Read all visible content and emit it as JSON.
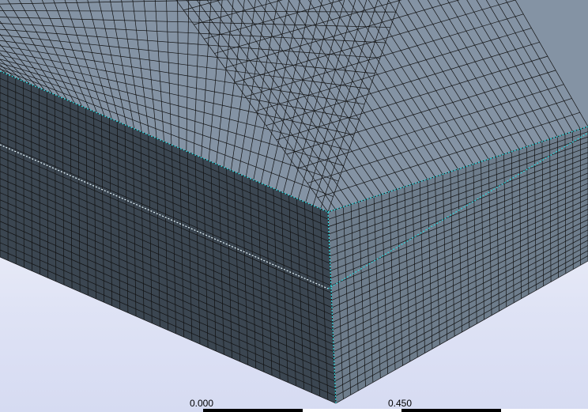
{
  "viewport": {
    "face_colors": {
      "top": "#8493a4",
      "left": "#3b4651",
      "right": "#6e7d8c",
      "edge": "#2fd8e0"
    }
  },
  "scale": {
    "labels": [
      "0.000",
      "0.450"
    ],
    "segment_colors": [
      "#000000",
      "#ffffff",
      "#000000",
      "#ffffff"
    ]
  }
}
